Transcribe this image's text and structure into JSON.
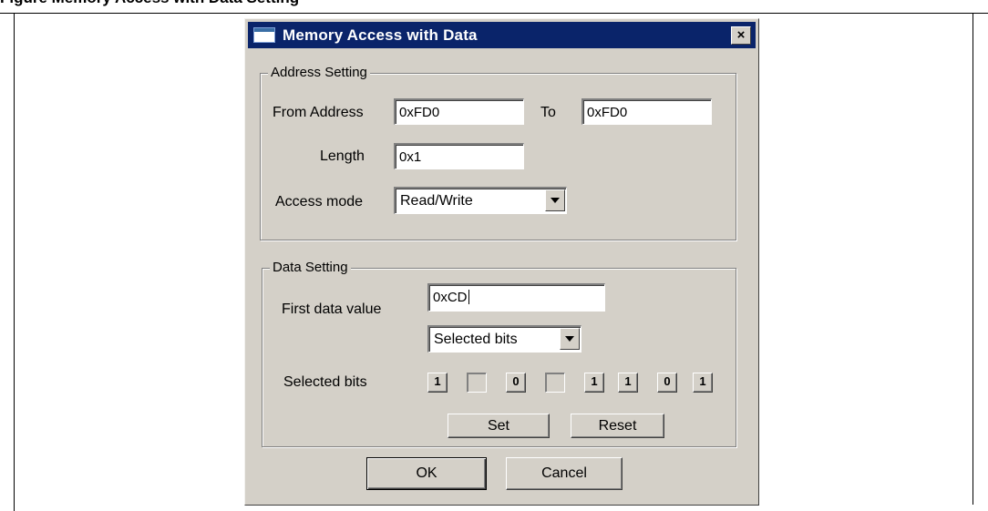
{
  "document": {
    "caption": "Figure       Memory Access with Data Setting"
  },
  "dialog": {
    "title": "Memory Access with Data",
    "close_glyph": "×",
    "address_setting": {
      "group_label": "Address Setting",
      "from_label": "From Address",
      "from_value": "0xFD0",
      "to_label": "To",
      "to_value": "0xFD0",
      "length_label": "Length",
      "length_value": "0x1",
      "access_mode_label": "Access mode",
      "access_mode_value": "Read/Write"
    },
    "data_setting": {
      "group_label": "Data Setting",
      "first_value_label": "First data value",
      "first_value": "0xCD",
      "mode_value": "Selected bits",
      "selected_bits_label": "Selected bits",
      "bits": [
        "1",
        "",
        "0",
        "",
        "1",
        "1",
        "0",
        "1"
      ],
      "set_label": "Set",
      "reset_label": "Reset"
    },
    "ok_label": "OK",
    "cancel_label": "Cancel"
  },
  "colors": {
    "titlebar": "#0a246a",
    "dialog_face": "#d4d0c8"
  }
}
